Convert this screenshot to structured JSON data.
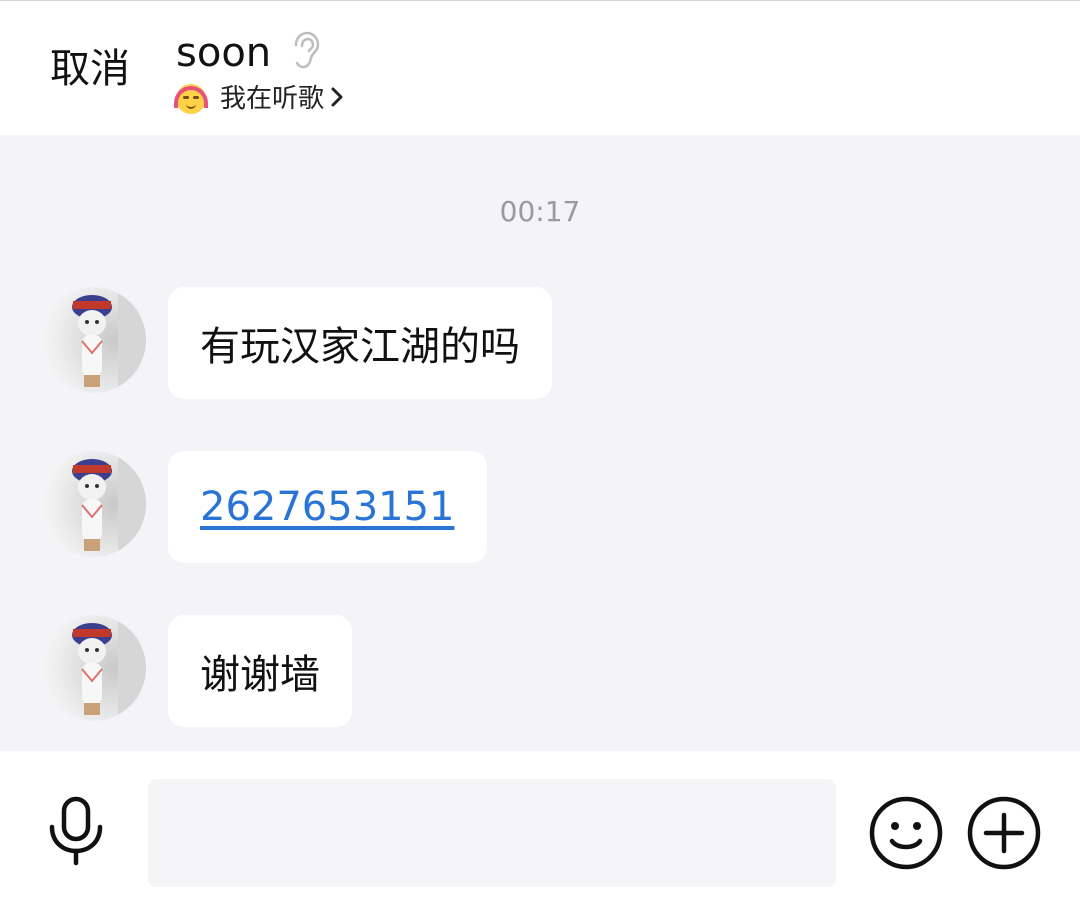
{
  "header": {
    "cancel_label": "取消",
    "title": "soon",
    "status_text": "我在听歌",
    "status_icon": "headphones-smile-emoji",
    "ear_icon": "ear-icon"
  },
  "chat": {
    "timestamp": "00:17",
    "messages": [
      {
        "text": "有玩汉家江湖的吗",
        "type": "text"
      },
      {
        "text": "2627653151",
        "type": "link"
      },
      {
        "text": "谢谢墙",
        "type": "text"
      }
    ]
  },
  "input": {
    "value": "",
    "placeholder": ""
  },
  "icons": {
    "mic": "microphone-icon",
    "emoji": "smiley-icon",
    "plus": "plus-circle-icon"
  },
  "colors": {
    "chat_background": "#f4f3f7",
    "link": "#2a74d6",
    "timestamp": "#9a9a9a"
  }
}
